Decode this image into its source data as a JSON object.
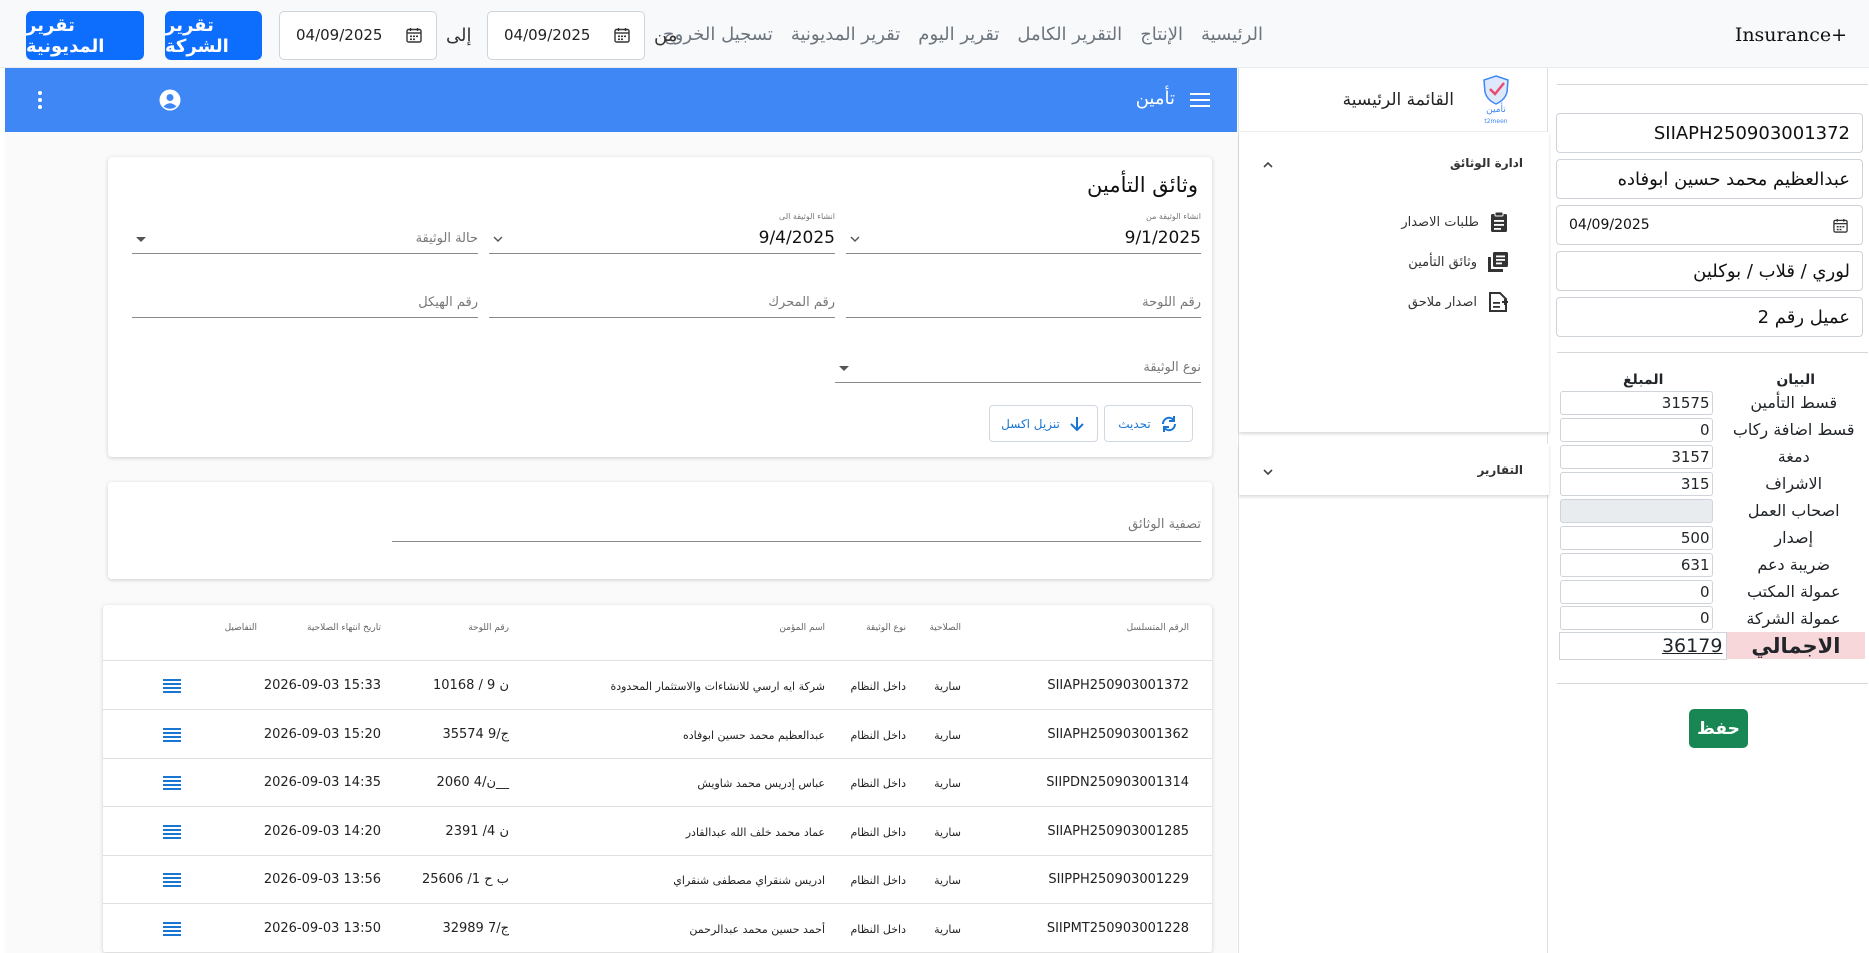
{
  "topnav": {
    "brand": "Insurance+",
    "links": [
      "الرئيسية",
      "الإنتاج",
      "التقرير الكامل",
      "تقرير اليوم",
      "تقرير المديونية",
      "تسجيل الخروج"
    ],
    "from_label": "من",
    "to_label": "إلى",
    "from_date": "04/09/2025",
    "to_date": "04/09/2025",
    "company_report_btn": "تقرير الشركة",
    "debt_report_btn": "تقرير المديونية"
  },
  "right_panel": {
    "policy_number": "SIIAPH250903001372",
    "customer_name": "عبدالعظيم محمد حسين ابوفاده",
    "date": "04/09/2025",
    "vehicle": "لوري / قلاب / بوكلين",
    "client": "عميل رقم 2",
    "table_headers": {
      "label": "البيان",
      "amount": "المبلغ"
    },
    "fees": [
      {
        "label": "قسط التأمين",
        "value": "31575"
      },
      {
        "label": "قسط اضافة ركاب",
        "value": "0"
      },
      {
        "label": "دمغة",
        "value": "3157"
      },
      {
        "label": "الاشراف",
        "value": "315"
      },
      {
        "label": "اصحاب العمل",
        "value": ""
      },
      {
        "label": "إصدار",
        "value": "500"
      },
      {
        "label": "ضريبة دعم",
        "value": "631"
      },
      {
        "label": "عمولة المكتب",
        "value": "0"
      },
      {
        "label": "عمولة الشركة",
        "value": "0"
      }
    ],
    "total_label": "الاجمالي",
    "total_value": "36179",
    "save_btn": "حفظ"
  },
  "sidebar": {
    "title": "القائمة الرئيسية",
    "logo_text": "تأمين",
    "logo_sub": "t2meen",
    "sections": [
      {
        "title": "ادارة الوثائق",
        "items": [
          "طلبات الاصدار",
          "وثائق التأمين",
          "اصدار ملاحق"
        ]
      },
      {
        "title": "التقارير",
        "items": []
      }
    ]
  },
  "appbar": {
    "title": "تأمين"
  },
  "filters": {
    "title": "وثائق التأمين",
    "created_from_label": "انشاء الوثيقة من",
    "created_from": "9/1/2025",
    "created_to_label": "انشاء الوثيقة الى",
    "created_to": "9/4/2025",
    "status_placeholder": "حالة الوثيقة",
    "plate_placeholder": "رقم اللوحة",
    "engine_placeholder": "رقم المحرك",
    "chassis_placeholder": "رقم الهيكل",
    "type_placeholder": "نوع الوثيقة",
    "refresh_btn": "تحديث",
    "excel_btn": "تنزيل اكسل"
  },
  "filter_card": {
    "placeholder": "تصفية الوثائق"
  },
  "table": {
    "headers": [
      "الرقم المتسلسل",
      "الصلاحية",
      "نوع الوثيقة",
      "اسم المؤمن",
      "رقم اللوحة",
      "تاريخ انتهاء الصلاحية",
      "التفاصيل"
    ],
    "rows": [
      [
        "SIIAPH250903001372",
        "سارية",
        "داخل النظام",
        "شركة ايه ارسي للانشاءات والاستثمار المحدودة",
        "ن 9 / 10168",
        "2026-09-03 15:33"
      ],
      [
        "SIIAPH250903001362",
        "سارية",
        "داخل النظام",
        "عبدالعظيم محمد حسين ابوفاده",
        "ج/9 35574",
        "2026-09-03 15:20"
      ],
      [
        "SIIPDN250903001314",
        "سارية",
        "داخل النظام",
        "عباس إدريس محمد شاويش",
        "ن/4 2060__",
        "2026-09-03 14:35"
      ],
      [
        "SIIAPH250903001285",
        "سارية",
        "داخل النظام",
        "عماد محمد خلف الله عبدالقادر",
        "ن 4/ 2391",
        "2026-09-03 14:20"
      ],
      [
        "SIIPPH250903001229",
        "سارية",
        "داخل النظام",
        "ادريس شنقراي مصطفى شنقراي",
        "ب ح 1/ 25606",
        "2026-09-03 13:56"
      ],
      [
        "SIIPMT250903001228",
        "سارية",
        "داخل النظام",
        "أحمد حسين محمد عبدالرحمن",
        "ج/7 32989",
        "2026-09-03 13:50"
      ]
    ]
  },
  "colors": {
    "primary": "#0d6efd",
    "appbar": "#3f87f5",
    "success": "#198754",
    "total_bg": "#f8d7da",
    "icon_blue": "#1976d2"
  },
  "icons": [
    "calendar-icon",
    "menu-icon",
    "user-icon",
    "more-vert-icon",
    "clipboard-icon",
    "library-icon",
    "note-add-icon",
    "chevron-up-icon",
    "chevron-down-icon",
    "refresh-icon",
    "download-icon",
    "details-icon"
  ]
}
